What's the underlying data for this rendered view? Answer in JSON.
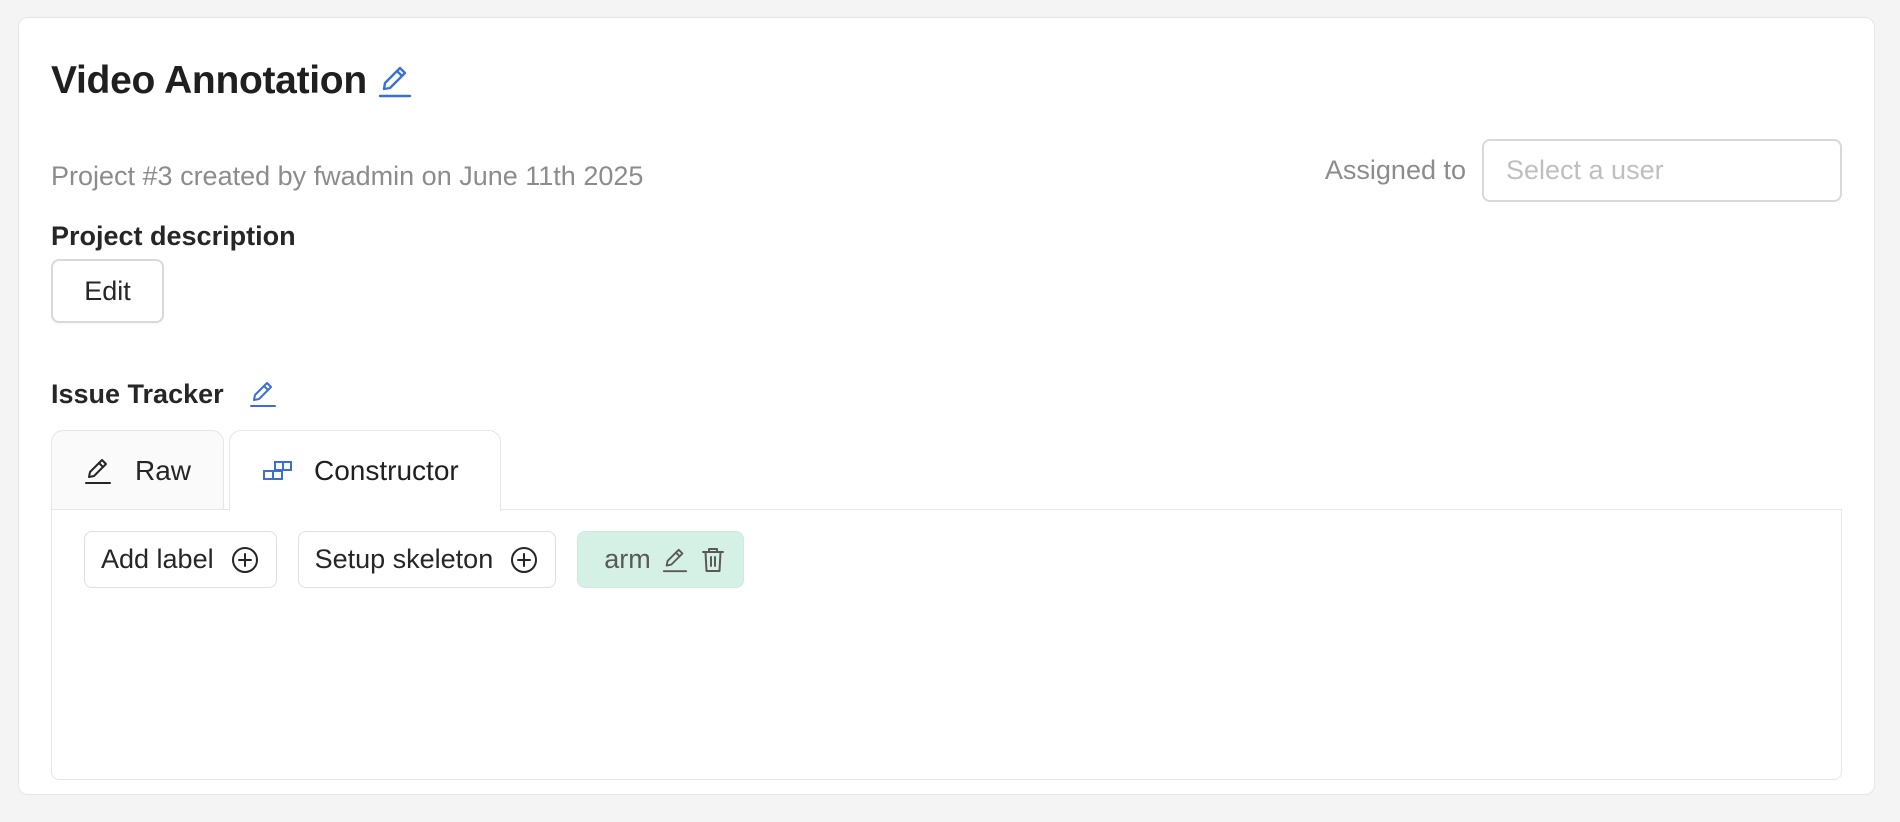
{
  "header": {
    "title": "Video Annotation",
    "edit_icon": "pencil-icon"
  },
  "meta": {
    "text": "Project #3 created by fwadmin on June 11th 2025"
  },
  "assignee": {
    "label": "Assigned to",
    "placeholder": "Select a user"
  },
  "description": {
    "title": "Project description",
    "edit_label": "Edit"
  },
  "issue_tracker": {
    "title": "Issue Tracker",
    "edit_icon": "pencil-icon"
  },
  "tabs": [
    {
      "label": "Raw",
      "icon": "pencil-icon",
      "active": false
    },
    {
      "label": "Constructor",
      "icon": "constructor-blocks-icon",
      "active": true
    }
  ],
  "constructor": {
    "add_label": "Add label",
    "setup_skeleton": "Setup skeleton",
    "labels": [
      {
        "name": "arm",
        "color": "#d5f0e5"
      }
    ]
  },
  "colors": {
    "accent": "#3b6fd8",
    "page_bg": "#f4f4f4",
    "label_bg": "#d5f0e5"
  }
}
